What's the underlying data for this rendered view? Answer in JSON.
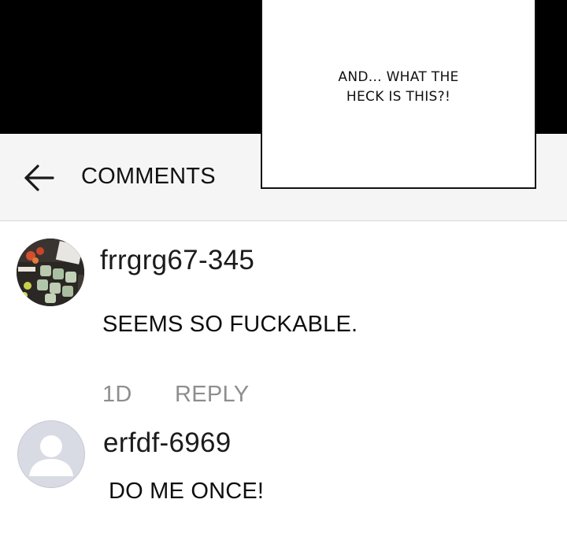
{
  "speech_bubble": {
    "line1": "AND... WHAT THE",
    "line2": "HECK IS THIS?!"
  },
  "header": {
    "back_icon": "arrow-left-icon",
    "title": "COMMENTS"
  },
  "comments": [
    {
      "username": "frrgrg67-345",
      "avatar": "photo",
      "text": "SEEMS SO FUCKABLE.",
      "time": "1D",
      "reply_label": "REPLY"
    },
    {
      "username": "erfdf-6969",
      "avatar": "default-user-icon",
      "text": "DO ME ONCE!"
    }
  ],
  "colors": {
    "background": "#ffffff",
    "header_background": "#f5f5f5",
    "panel_black": "#000000",
    "meta_gray": "#8e8e8e",
    "default_avatar": "#d8dae4"
  }
}
